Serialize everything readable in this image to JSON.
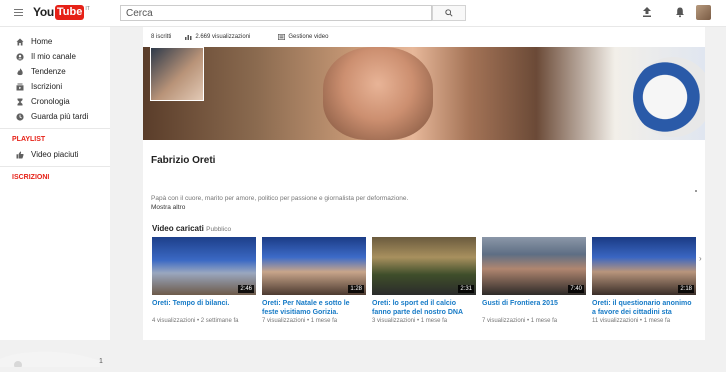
{
  "header": {
    "logo_you": "You",
    "logo_tube": "Tube",
    "logo_region": "IT",
    "search_placeholder": "Cerca"
  },
  "sidebar": {
    "items": [
      {
        "label": "Home",
        "icon": "home-icon"
      },
      {
        "label": "Il mio canale",
        "icon": "person-icon"
      },
      {
        "label": "Tendenze",
        "icon": "flame-icon"
      },
      {
        "label": "Iscrizioni",
        "icon": "subscriptions-icon"
      },
      {
        "label": "Cronologia",
        "icon": "hourglass-icon"
      },
      {
        "label": "Guarda più tardi",
        "icon": "clock-icon"
      }
    ],
    "playlist_heading": "PLAYLIST",
    "playlist_items": [
      {
        "label": "Video piaciuti",
        "icon": "thumbs-up-icon"
      }
    ],
    "subscriptions_heading": "ISCRIZIONI",
    "bottom_number": "1"
  },
  "stats": {
    "subscribers": "8 iscritti",
    "views": "2.669 visualizzazioni",
    "manage": "Gestione video"
  },
  "channel": {
    "name": "Fabrizio Oreti",
    "description": "Papà con il cuore, marito per amore, politico per passione e giornalista per deformazione.",
    "more": "Mostra altro"
  },
  "uploads": {
    "title": "Video caricati",
    "visibility": "Pubblico",
    "videos": [
      {
        "title": "Oreti: Tempo di bilanci.",
        "views": "4 visualizzazioni",
        "age": "2 settimane fa",
        "duration": "2:46"
      },
      {
        "title": "Oreti: Per Natale e sotto le feste visitiamo Gorizia.",
        "views": "7 visualizzazioni",
        "age": "1 mese fa",
        "duration": "1:28"
      },
      {
        "title": "Oreti: lo sport ed il calcio fanno parte del nostro DNA nazionale.",
        "views": "3 visualizzazioni",
        "age": "1 mese fa",
        "duration": "2:31"
      },
      {
        "title": "Gusti di Frontiera 2015",
        "views": "7 visualizzazioni",
        "age": "1 mese fa",
        "duration": "7:40"
      },
      {
        "title": "Oreti: il questionario anonimo a favore dei cittadini sta ottenen...",
        "views": "11 visualizzazioni",
        "age": "1 mese fa",
        "duration": "2:18"
      }
    ]
  },
  "colors": {
    "brand_red": "#e62117",
    "link_blue": "#167ac6"
  }
}
